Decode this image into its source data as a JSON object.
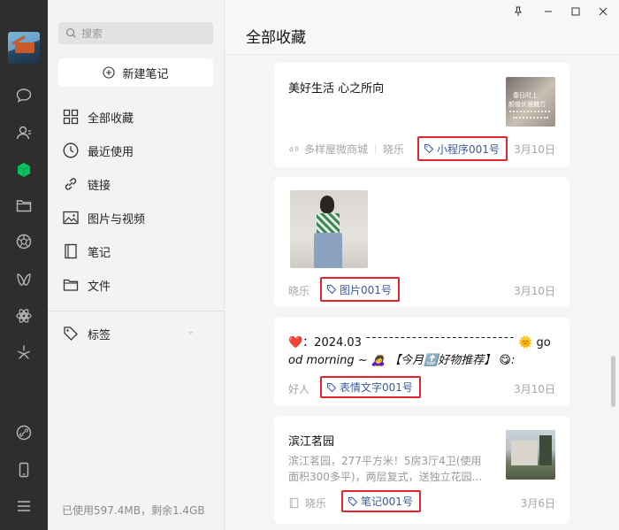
{
  "sidebar": {
    "search_placeholder": "搜索",
    "new_note_label": "新建笔记",
    "items": [
      {
        "label": "全部收藏",
        "icon": "grid-icon"
      },
      {
        "label": "最近使用",
        "icon": "clock-icon"
      },
      {
        "label": "链接",
        "icon": "link-icon"
      },
      {
        "label": "图片与视频",
        "icon": "image-icon"
      },
      {
        "label": "笔记",
        "icon": "notebook-icon"
      },
      {
        "label": "文件",
        "icon": "folder-icon"
      }
    ],
    "tags_label": "标签",
    "storage": "已使用597.4MB，剩余1.4GB"
  },
  "main": {
    "title": "全部收藏",
    "cards": [
      {
        "title": "美好生活 心之所向",
        "source": "多样屋微商城",
        "author": "晓乐",
        "tag": "小程序001号",
        "date": "3月10日"
      },
      {
        "author": "晓乐",
        "tag": "图片001号",
        "date": "3月10日"
      },
      {
        "line1": "❤️：2024.03 ˉˉˉˉˉˉˉˉˉˉˉˉˉˉˉˉˉˉˉˉˉˉˉˉˉˉ 🌞 go",
        "line2": "od morning ~ 🙇‍♀️ 【今月🔝好物推荐】 😋:",
        "author": "好人",
        "tag": "表情文字001号",
        "date": "3月10日"
      },
      {
        "title": "滨江茗园",
        "body_line1": "滨江茗园，277平方米！5房3厅4卫(使用",
        "body_line2": "面积300多平)，两层复式，送独立花园...",
        "author": "晓乐",
        "tag": "笔记001号",
        "date": "3月6日"
      }
    ],
    "thumb1_text_1": "春日时上",
    "thumb1_text_2": "颜值优雅魅力"
  },
  "colors": {
    "rail": "#2e2e2e",
    "accent_green": "#07c160",
    "tag_border": "#e0252b",
    "tag_text": "#3a5a9c"
  }
}
